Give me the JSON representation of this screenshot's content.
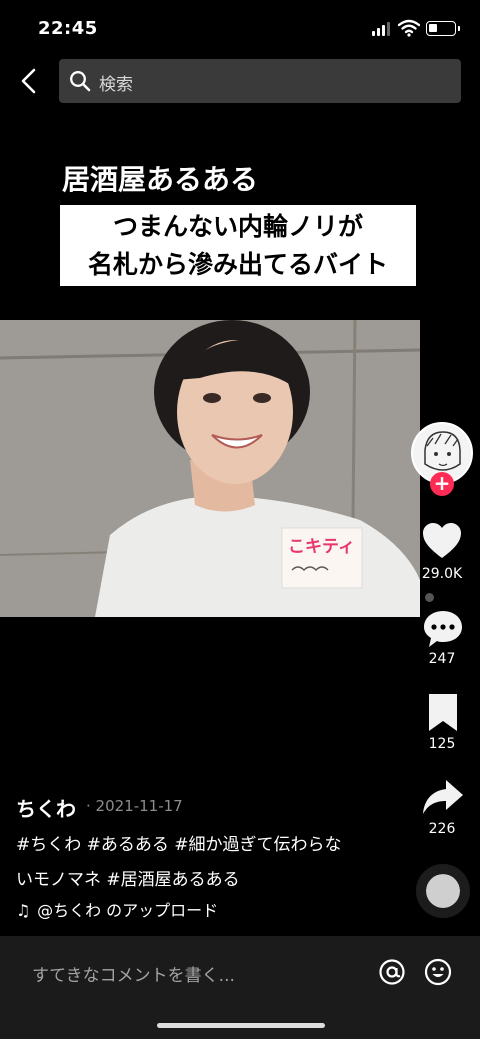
{
  "status_bar": {
    "time": "22:45"
  },
  "search": {
    "placeholder": "検索"
  },
  "video": {
    "caption_title": "居酒屋あるある",
    "caption_line1": "つまんない内輪ノリが",
    "caption_line2": "名札から滲み出てるバイト",
    "name_tag": "こキティ"
  },
  "actions": {
    "likes": "29.0K",
    "comments": "247",
    "saves": "125",
    "shares": "226"
  },
  "post": {
    "username": "ちくわ",
    "date": "· 2021-11-17",
    "description_line1": "#ちくわ #あるある #細か過ぎて伝わらな",
    "description_line2": "いモノマネ #居酒屋あるある",
    "music": "@ちくわ のアップロード"
  },
  "comment_bar": {
    "placeholder": "すてきなコメントを書く..."
  },
  "colors": {
    "accent": "#fe2c55",
    "bar_bg": "#1b1b1b",
    "search_bg": "#3a3a3a"
  }
}
